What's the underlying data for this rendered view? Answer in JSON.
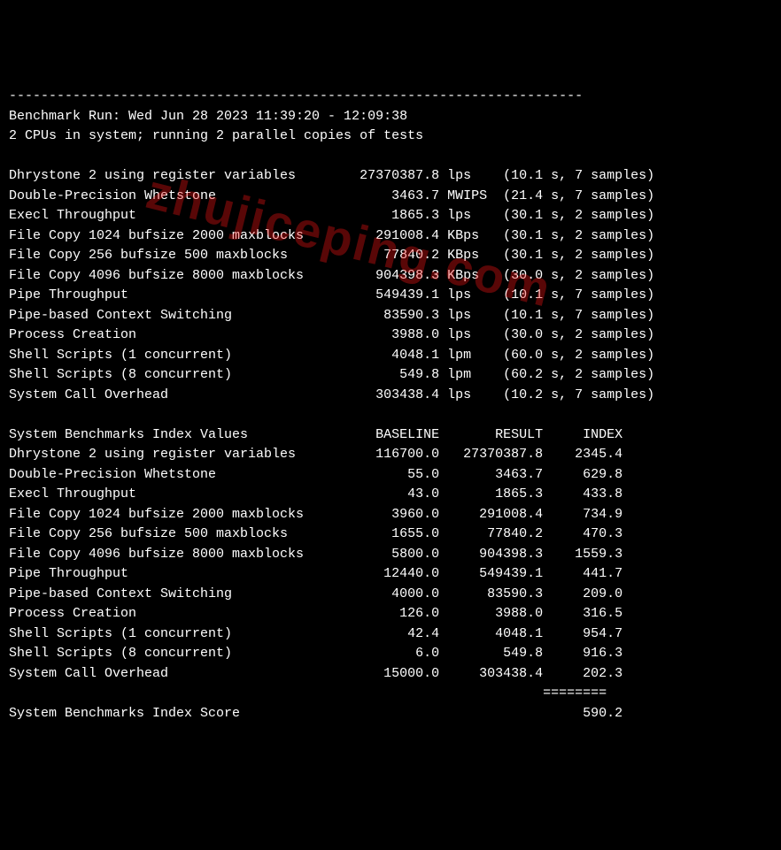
{
  "divider": "------------------------------------------------------------------------",
  "header": {
    "run_line": "Benchmark Run: Wed Jun 28 2023 11:39:20 - 12:09:38",
    "cpu_line": "2 CPUs in system; running 2 parallel copies of tests"
  },
  "results": [
    {
      "name": "Dhrystone 2 using register variables",
      "value": "27370387.8",
      "unit": "lps",
      "time": "10.1",
      "samples": "7"
    },
    {
      "name": "Double-Precision Whetstone",
      "value": "3463.7",
      "unit": "MWIPS",
      "time": "21.4",
      "samples": "7"
    },
    {
      "name": "Execl Throughput",
      "value": "1865.3",
      "unit": "lps",
      "time": "30.1",
      "samples": "2"
    },
    {
      "name": "File Copy 1024 bufsize 2000 maxblocks",
      "value": "291008.4",
      "unit": "KBps",
      "time": "30.1",
      "samples": "2"
    },
    {
      "name": "File Copy 256 bufsize 500 maxblocks",
      "value": "77840.2",
      "unit": "KBps",
      "time": "30.1",
      "samples": "2"
    },
    {
      "name": "File Copy 4096 bufsize 8000 maxblocks",
      "value": "904398.3",
      "unit": "KBps",
      "time": "30.0",
      "samples": "2"
    },
    {
      "name": "Pipe Throughput",
      "value": "549439.1",
      "unit": "lps",
      "time": "10.1",
      "samples": "7"
    },
    {
      "name": "Pipe-based Context Switching",
      "value": "83590.3",
      "unit": "lps",
      "time": "10.1",
      "samples": "7"
    },
    {
      "name": "Process Creation",
      "value": "3988.0",
      "unit": "lps",
      "time": "30.0",
      "samples": "2"
    },
    {
      "name": "Shell Scripts (1 concurrent)",
      "value": "4048.1",
      "unit": "lpm",
      "time": "60.0",
      "samples": "2"
    },
    {
      "name": "Shell Scripts (8 concurrent)",
      "value": "549.8",
      "unit": "lpm",
      "time": "60.2",
      "samples": "2"
    },
    {
      "name": "System Call Overhead",
      "value": "303438.4",
      "unit": "lps",
      "time": "10.2",
      "samples": "7"
    }
  ],
  "index_header": {
    "title": "System Benchmarks Index Values",
    "c1": "BASELINE",
    "c2": "RESULT",
    "c3": "INDEX"
  },
  "index_rows": [
    {
      "name": "Dhrystone 2 using register variables",
      "baseline": "116700.0",
      "result": "27370387.8",
      "index": "2345.4"
    },
    {
      "name": "Double-Precision Whetstone",
      "baseline": "55.0",
      "result": "3463.7",
      "index": "629.8"
    },
    {
      "name": "Execl Throughput",
      "baseline": "43.0",
      "result": "1865.3",
      "index": "433.8"
    },
    {
      "name": "File Copy 1024 bufsize 2000 maxblocks",
      "baseline": "3960.0",
      "result": "291008.4",
      "index": "734.9"
    },
    {
      "name": "File Copy 256 bufsize 500 maxblocks",
      "baseline": "1655.0",
      "result": "77840.2",
      "index": "470.3"
    },
    {
      "name": "File Copy 4096 bufsize 8000 maxblocks",
      "baseline": "5800.0",
      "result": "904398.3",
      "index": "1559.3"
    },
    {
      "name": "Pipe Throughput",
      "baseline": "12440.0",
      "result": "549439.1",
      "index": "441.7"
    },
    {
      "name": "Pipe-based Context Switching",
      "baseline": "4000.0",
      "result": "83590.3",
      "index": "209.0"
    },
    {
      "name": "Process Creation",
      "baseline": "126.0",
      "result": "3988.0",
      "index": "316.5"
    },
    {
      "name": "Shell Scripts (1 concurrent)",
      "baseline": "42.4",
      "result": "4048.1",
      "index": "954.7"
    },
    {
      "name": "Shell Scripts (8 concurrent)",
      "baseline": "6.0",
      "result": "549.8",
      "index": "916.3"
    },
    {
      "name": "System Call Overhead",
      "baseline": "15000.0",
      "result": "303438.4",
      "index": "202.3"
    }
  ],
  "score_divider": "                                                                   ========",
  "score": {
    "label": "System Benchmarks Index Score",
    "value": "590.2"
  },
  "watermark": "zhujiceping.com"
}
